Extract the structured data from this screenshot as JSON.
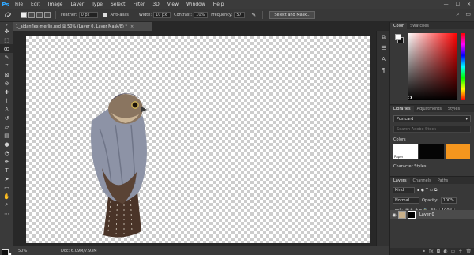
{
  "app": {
    "logo": "Ps"
  },
  "menubar": {
    "items": [
      "File",
      "Edit",
      "Image",
      "Layer",
      "Type",
      "Select",
      "Filter",
      "3D",
      "View",
      "Window",
      "Help"
    ]
  },
  "window_controls": {
    "minimize": "—",
    "maximize": "☐",
    "close": "✕"
  },
  "options_bar": {
    "feather_label": "Feather:",
    "feather_value": "0 px",
    "antialias_label": "Anti-alias",
    "width_label": "Width:",
    "width_value": "10 px",
    "contrast_label": "Contrast:",
    "contrast_value": "10%",
    "frequency_label": "Frequency:",
    "frequency_value": "57",
    "select_mask_button": "Select and Mask..."
  },
  "document": {
    "tab_title": "1_aidanflex-merlin.psd @ 50% (Layer 0, Layer Mask/8) *",
    "close": "×",
    "zoom": "50%",
    "doc_info": "Doc: 6.09M/7.93M"
  },
  "color_panel": {
    "tabs": [
      "Color",
      "Swatches"
    ]
  },
  "libraries_panel": {
    "tabs": [
      "Libraries",
      "Adjustments",
      "Styles"
    ],
    "library_name": "Postcard",
    "search_placeholder": "Search Adobe Stock",
    "colors_title": "Colors",
    "chips": [
      {
        "label": "Paper",
        "color": "#ffffff"
      },
      {
        "label": "",
        "color": "#050505"
      },
      {
        "label": "",
        "color": "#f5961e"
      }
    ],
    "character_styles_title": "Character Styles"
  },
  "layers_panel": {
    "tabs": [
      "Layers",
      "Channels",
      "Paths"
    ],
    "filter_kind": "Kind",
    "blend_mode": "Normal",
    "opacity_label": "Opacity:",
    "opacity_value": "100%",
    "lock_label": "Lock:",
    "fill_label": "Fill:",
    "fill_value": "100%",
    "layers": [
      {
        "name": "Layer 0"
      }
    ]
  }
}
